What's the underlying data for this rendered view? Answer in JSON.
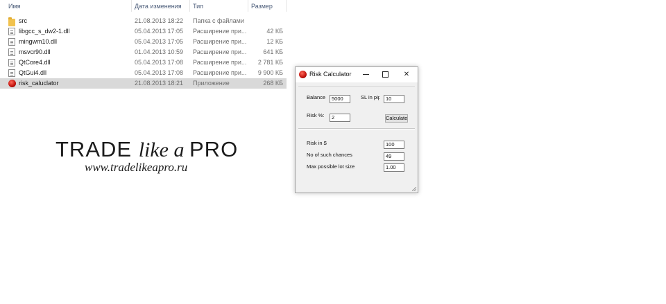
{
  "explorer": {
    "columns": {
      "name": "Имя",
      "date": "Дата изменения",
      "type": "Тип",
      "size": "Размер"
    },
    "files": [
      {
        "name": "src",
        "date": "21.08.2013 18:22",
        "type": "Папка с файлами",
        "size": "",
        "icon": "folder-icon"
      },
      {
        "name": "libgcc_s_dw2-1.dll",
        "date": "05.04.2013 17:05",
        "type": "Расширение при...",
        "size": "42 КБ",
        "icon": "dll-file-icon"
      },
      {
        "name": "mingwm10.dll",
        "date": "05.04.2013 17:05",
        "type": "Расширение при...",
        "size": "12 КБ",
        "icon": "dll-file-icon"
      },
      {
        "name": "msvcr90.dll",
        "date": "01.04.2013 10:59",
        "type": "Расширение при...",
        "size": "641 КБ",
        "icon": "dll-file-icon"
      },
      {
        "name": "QtCore4.dll",
        "date": "05.04.2013 17:08",
        "type": "Расширение при...",
        "size": "2 781 КБ",
        "icon": "dll-file-icon"
      },
      {
        "name": "QtGui4.dll",
        "date": "05.04.2013 17:08",
        "type": "Расширение при...",
        "size": "9 900 КБ",
        "icon": "dll-file-icon"
      },
      {
        "name": "risk_caluclator",
        "date": "21.08.2013 18:21",
        "type": "Приложение",
        "size": "268 КБ",
        "icon": "app-icon",
        "selected": true
      }
    ]
  },
  "logo": {
    "trade": "TRADE ",
    "like_a": "like a ",
    "pro": "PRO",
    "url": "www.tradelikeapro.ru"
  },
  "calculator": {
    "title": "Risk Calculator",
    "balance_label": "Balance",
    "balance_value": "5000",
    "sl_label": "SL in pip",
    "sl_value": "10",
    "risk_pct_label": "Risk %:",
    "risk_pct_value": "2",
    "calculate_label": "Calculate",
    "risk_usd_label": "Risk in $",
    "risk_usd_value": "100",
    "chances_label": "No of such chances le",
    "chances_value": "49",
    "max_lot_label": "Max possible lot size:",
    "max_lot_value": "1.00"
  },
  "colors": {
    "selected_row": "#d9d9d9",
    "folder": "#f1c24e",
    "app_icon": "#c0110c"
  }
}
